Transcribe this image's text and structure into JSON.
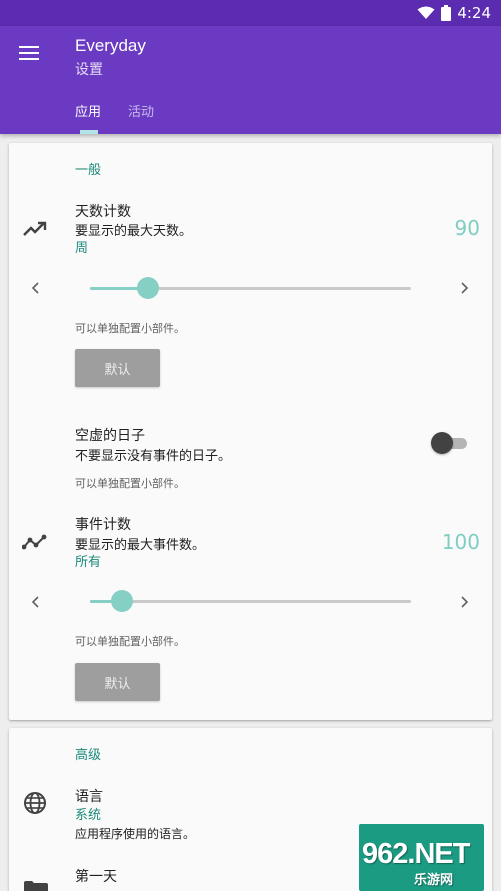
{
  "status_bar": {
    "time": "4:24"
  },
  "app_bar": {
    "title": "Everyday",
    "subtitle": "设置",
    "tabs": [
      {
        "label": "应用",
        "selected": true
      },
      {
        "label": "活动",
        "selected": false
      }
    ]
  },
  "general": {
    "section_title": "一般",
    "days_count": {
      "icon": "trending-up-icon",
      "title": "天数计数",
      "summary": "要显示的最大天数。",
      "value_label": "周",
      "value": "90",
      "slider_fraction": 0.18,
      "hint": "可以单独配置小部件。",
      "default_button": "默认"
    },
    "empty_days": {
      "title": "空虚的日子",
      "summary": "不要显示没有事件的日子。",
      "enabled": false,
      "hint": "可以单独配置小部件。"
    },
    "event_count": {
      "icon": "timeline-icon",
      "title": "事件计数",
      "summary": "要显示的最大事件数。",
      "value_label": "所有",
      "value": "100",
      "slider_fraction": 0.1,
      "hint": "可以单独配置小部件。",
      "default_button": "默认"
    }
  },
  "advanced": {
    "section_title": "高级",
    "language": {
      "icon": "globe-icon",
      "title": "语言",
      "value_label": "系统",
      "summary": "应用程序使用的语言。"
    },
    "first_day": {
      "icon": "folder-icon",
      "title": "第一天"
    }
  },
  "watermark": {
    "brand": "962.NET",
    "sub": "乐游网"
  },
  "colors": {
    "status_bar": "#5b2bb0",
    "app_bar": "#6a3bc2",
    "accent": "#1b8a7a",
    "slider": "#86cfc5",
    "fab": "#1a9b82"
  }
}
